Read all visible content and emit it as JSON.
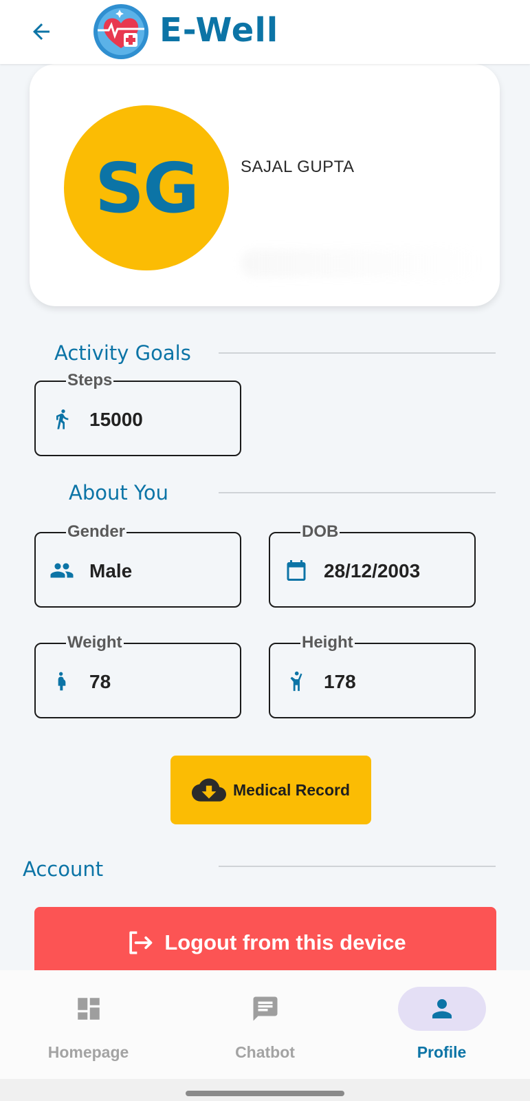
{
  "header": {
    "app_title": "E-Well"
  },
  "profile": {
    "initials": "SG",
    "name": "SAJAL GUPTA"
  },
  "activity_goals": {
    "section_title": "Activity Goals",
    "steps": {
      "label": "Steps",
      "value": "15000",
      "icon": "walking-person-icon"
    }
  },
  "about_you": {
    "section_title": "About You",
    "gender": {
      "label": "Gender",
      "value": "Male",
      "icon": "people-icon"
    },
    "dob": {
      "label": "DOB",
      "value": "28/12/2003",
      "icon": "calendar-icon"
    },
    "weight": {
      "label": "Weight",
      "value": "78",
      "icon": "pregnant-person-icon"
    },
    "height": {
      "label": "Height",
      "value": "178",
      "icon": "person-raising-hand-icon"
    }
  },
  "medical_record_button": {
    "label": "Medical Record",
    "icon": "cloud-download-icon"
  },
  "account": {
    "section_title": "Account",
    "logout_label": "Logout from this device",
    "logout_icon": "logout-icon"
  },
  "bottom_nav": {
    "items": [
      {
        "label": "Homepage",
        "icon": "dashboard-icon",
        "active": false
      },
      {
        "label": "Chatbot",
        "icon": "chat-icon",
        "active": false
      },
      {
        "label": "Profile",
        "icon": "person-icon",
        "active": true
      }
    ]
  },
  "colors": {
    "brand_blue": "#0c74a6",
    "accent_yellow": "#fbbc04",
    "logout_red": "#fc5454",
    "background": "#f3f6f9",
    "nav_active_pill": "#e4dff5"
  }
}
